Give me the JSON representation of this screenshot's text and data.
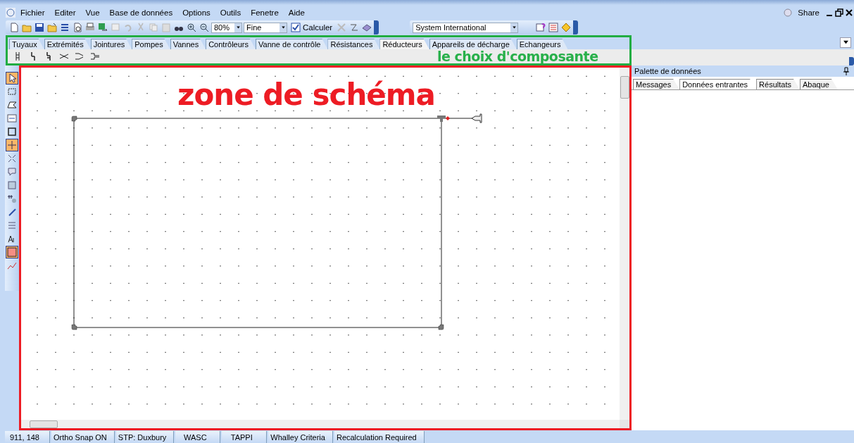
{
  "menu": [
    "Fichier",
    "Editer",
    "Vue",
    "Base de données",
    "Options",
    "Outils",
    "Fenetre",
    "Aide"
  ],
  "share": "Share",
  "toolbar": {
    "zoom": "80%",
    "mesh": "Fine",
    "calculate": "Calculer",
    "units": "System International"
  },
  "component_tabs": [
    {
      "label": "Tuyaux",
      "selected": false
    },
    {
      "label": "Extrémités",
      "selected": false
    },
    {
      "label": "Jointures",
      "selected": false
    },
    {
      "label": "Pompes",
      "selected": false
    },
    {
      "label": "Vannes",
      "selected": false
    },
    {
      "label": "Contrôleurs",
      "selected": false
    },
    {
      "label": "Vanne de contrôle",
      "selected": false
    },
    {
      "label": "Résistances",
      "selected": false
    },
    {
      "label": "Réducteurs",
      "selected": true
    },
    {
      "label": "Appareils de décharge",
      "selected": false
    },
    {
      "label": "Echangeurs",
      "selected": false
    }
  ],
  "annotations": {
    "components": "le choix d'composante",
    "diagram": "zone de schéma"
  },
  "tools": [
    {
      "kind": "pointer",
      "selected": true
    },
    {
      "kind": "marquee",
      "selected": false
    },
    {
      "kind": "lasso",
      "selected": false
    },
    {
      "kind": "textbox",
      "selected": false
    },
    {
      "kind": "frame",
      "selected": false
    },
    {
      "kind": "move",
      "selected": true
    },
    {
      "kind": "scale",
      "selected": false
    },
    {
      "kind": "comment",
      "selected": false
    },
    {
      "kind": "label",
      "selected": false
    },
    {
      "kind": "number",
      "selected": false
    },
    {
      "kind": "pen",
      "selected": false
    },
    {
      "kind": "list",
      "selected": false
    },
    {
      "kind": "text",
      "selected": false
    },
    {
      "kind": "fill",
      "selected": true
    },
    {
      "kind": "chart",
      "selected": false
    }
  ],
  "data_palette": {
    "title": "Palette de données",
    "tabs": [
      {
        "label": "Messages",
        "selected": false
      },
      {
        "label": "Données entrantes",
        "selected": true
      },
      {
        "label": "Résultats",
        "selected": false
      },
      {
        "label": "Abaque",
        "selected": false
      }
    ]
  },
  "status_bar": [
    "911, 148",
    "Ortho Snap ON",
    "STP: Duxbury",
    "WASC",
    "TAPPI",
    "Whalley Criteria",
    "Recalculation Required"
  ]
}
